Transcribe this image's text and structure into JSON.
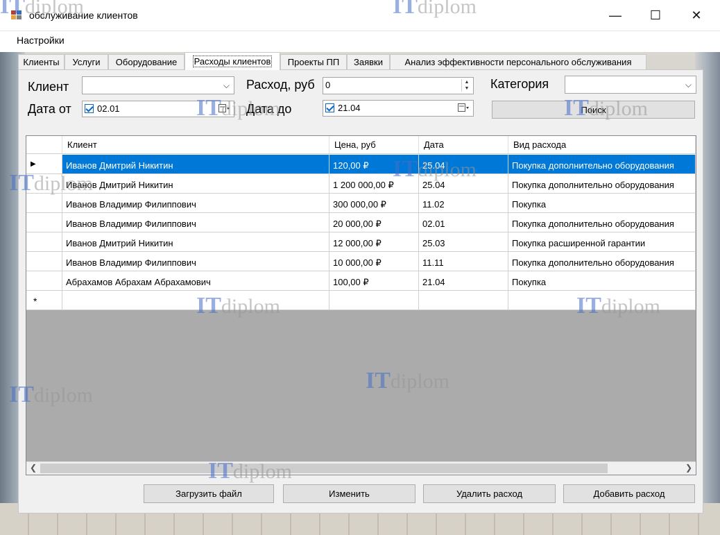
{
  "window": {
    "title": "обслуживание клиентов",
    "minimize_icon": "minimize-icon",
    "maximize_icon": "maximize-icon",
    "close_icon": "close-icon"
  },
  "menu": {
    "settings_label": "Настройки"
  },
  "tabs": [
    {
      "label": "Клиенты"
    },
    {
      "label": "Услуги"
    },
    {
      "label": "Оборудование"
    },
    {
      "label": "Расходы клиентов",
      "active": true
    },
    {
      "label": "Проекты ПП"
    },
    {
      "label": "Заявки"
    },
    {
      "label": "Анализ эффективности персонального обслуживания"
    }
  ],
  "filters": {
    "client_label": "Клиент",
    "client_value": "",
    "expense_label": "Расход, руб",
    "expense_value": "0",
    "category_label": "Категория",
    "category_value": "",
    "date_from_label": "Дата от",
    "date_from_value": "02.01",
    "date_to_label": "Дата до",
    "date_to_value": "21.04",
    "search_button": "Поиск"
  },
  "grid": {
    "columns": [
      "Клиент",
      "Цена, руб",
      "Дата",
      "Вид расхода"
    ],
    "rows": [
      {
        "client": "Иванов Дмитрий Никитин",
        "price": "120,00 ₽",
        "date": "25.04",
        "type": "Покупка дополнительно оборудования",
        "selected": true
      },
      {
        "client": "Иванов Дмитрий Никитин",
        "price": "1 200 000,00 ₽",
        "date": "25.04",
        "type": "Покупка дополнительно оборудования"
      },
      {
        "client": "Иванов Владимир Филиппович",
        "price": "300 000,00 ₽",
        "date": "11.02",
        "type": "Покупка"
      },
      {
        "client": "Иванов Владимир Филиппович",
        "price": "20 000,00 ₽",
        "date": "02.01",
        "type": "Покупка дополнительно оборудования"
      },
      {
        "client": "Иванов Дмитрий Никитин",
        "price": "12 000,00 ₽",
        "date": "25.03",
        "type": "Покупка расширенной гарантии"
      },
      {
        "client": "Иванов Владимир Филиппович",
        "price": "10 000,00 ₽",
        "date": "11.11",
        "type": "Покупка дополнительно оборудования"
      },
      {
        "client": "Абрахамов Абрахам Абрахамович",
        "price": "100,00 ₽",
        "date": "21.04",
        "type": "Покупка"
      }
    ],
    "current_row_marker": "▶",
    "new_row_marker": "*"
  },
  "actions": {
    "load_file": "Загрузить файл",
    "edit": "Изменить",
    "delete_expense": "Удалить расход",
    "add_expense": "Добавить расход"
  },
  "watermark": {
    "part1": "IT",
    "part2": "diplom"
  },
  "colors": {
    "selection": "#0078d7",
    "grid_empty": "#ababab",
    "panel": "#f0f0f0",
    "checkbox": "#0a64c8"
  }
}
